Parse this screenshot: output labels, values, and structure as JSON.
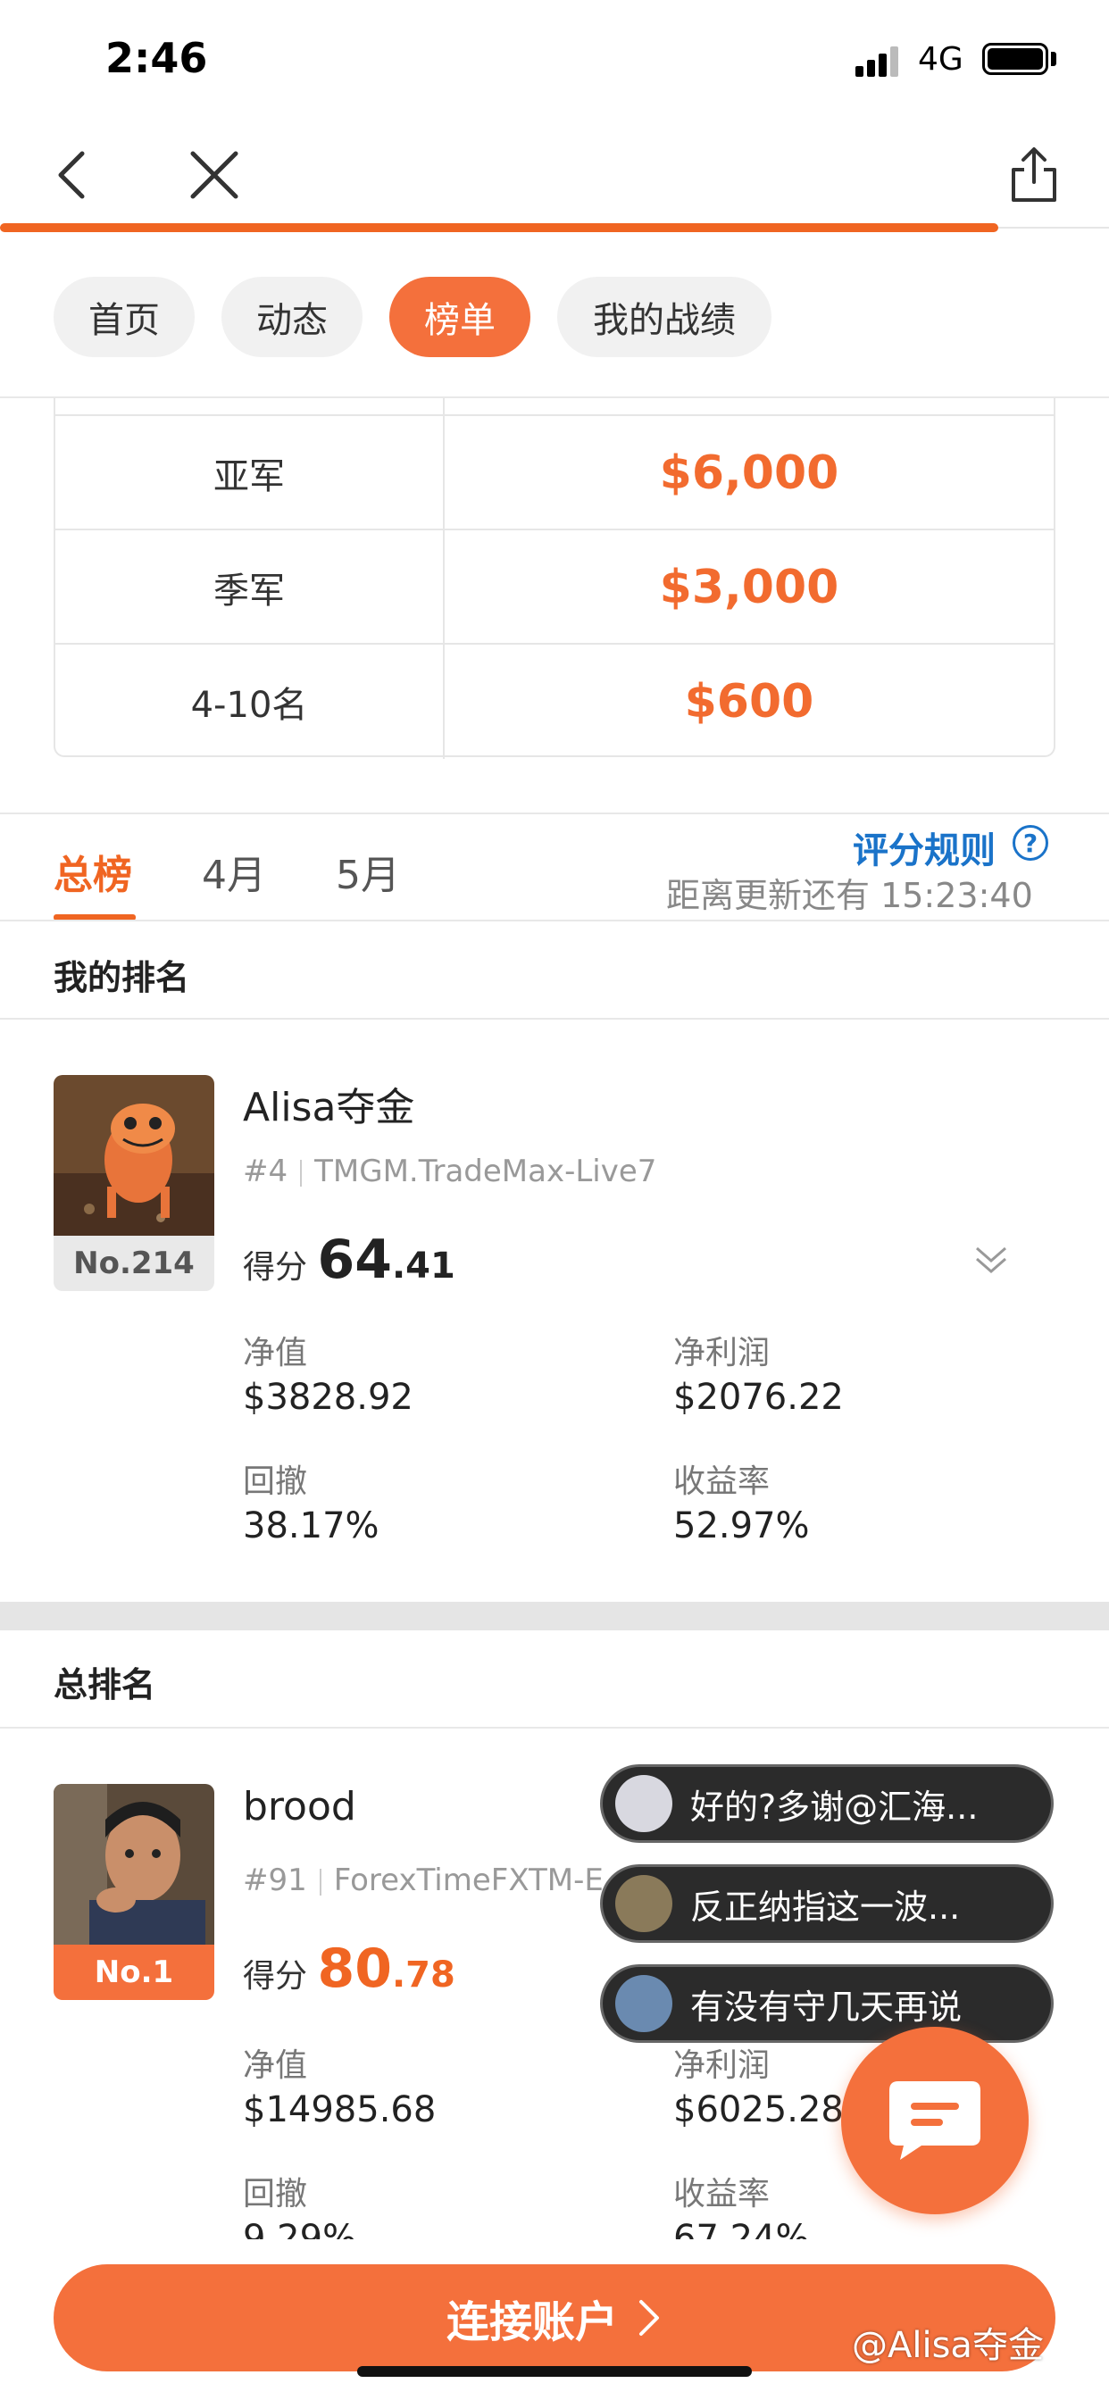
{
  "status_bar": {
    "time": "2:46",
    "network": "4G"
  },
  "nav": {
    "back_icon": "chevron-left-icon",
    "close_icon": "close-icon",
    "share_icon": "share-icon",
    "load_progress": 0.9
  },
  "tabs": [
    {
      "label": "首页",
      "active": false
    },
    {
      "label": "动态",
      "active": false
    },
    {
      "label": "榜单",
      "active": true
    },
    {
      "label": "我的战绩",
      "active": false
    }
  ],
  "prizes": [
    {
      "place": "亚军",
      "amount": "$6,000"
    },
    {
      "place": "季军",
      "amount": "$3,000"
    },
    {
      "place": "4-10名",
      "amount": "$600"
    }
  ],
  "leaderboard_tabs": [
    {
      "label": "总榜",
      "active": true
    },
    {
      "label": "4月",
      "active": false
    },
    {
      "label": "5月",
      "active": false
    }
  ],
  "rules_link": "评分规则",
  "update_text": "距离更新还有 15:23:40",
  "my_rank": {
    "section_title": "我的排名",
    "name": "Alisa夺金",
    "rank_badge": "No.214",
    "hash": "#4",
    "account": "TMGM.TradeMax-Live7",
    "score_label": "得分",
    "score_int": "64",
    "score_dec": ".41",
    "stats": [
      {
        "label": "净值",
        "value": "$3828.92"
      },
      {
        "label": "净利润",
        "value": "$2076.22"
      },
      {
        "label": "回撤",
        "value": "38.17%"
      },
      {
        "label": "收益率",
        "value": "52.97%"
      }
    ]
  },
  "overall": {
    "section_title": "总排名",
    "name": "brood",
    "rank_badge": "No.1",
    "hash": "#91",
    "account": "ForexTimeFXTM-E",
    "score_label": "得分",
    "score_int": "80",
    "score_dec": ".78",
    "stats": [
      {
        "label": "净值",
        "value": "$14985.68"
      },
      {
        "label": "净利润",
        "value": "$6025.28"
      },
      {
        "label": "回撤",
        "value": "9.29%"
      },
      {
        "label": "收益率",
        "value": "67.24%"
      }
    ]
  },
  "chat_bubbles": [
    {
      "text": "好的?多谢@汇海..."
    },
    {
      "text": "反正纳指这一波..."
    },
    {
      "text": "有没有守几天再说"
    }
  ],
  "cta": {
    "label": "连接账户"
  },
  "watermark": "@Alisa夺金",
  "colors": {
    "accent": "#f06522",
    "link": "#1a73c9"
  }
}
